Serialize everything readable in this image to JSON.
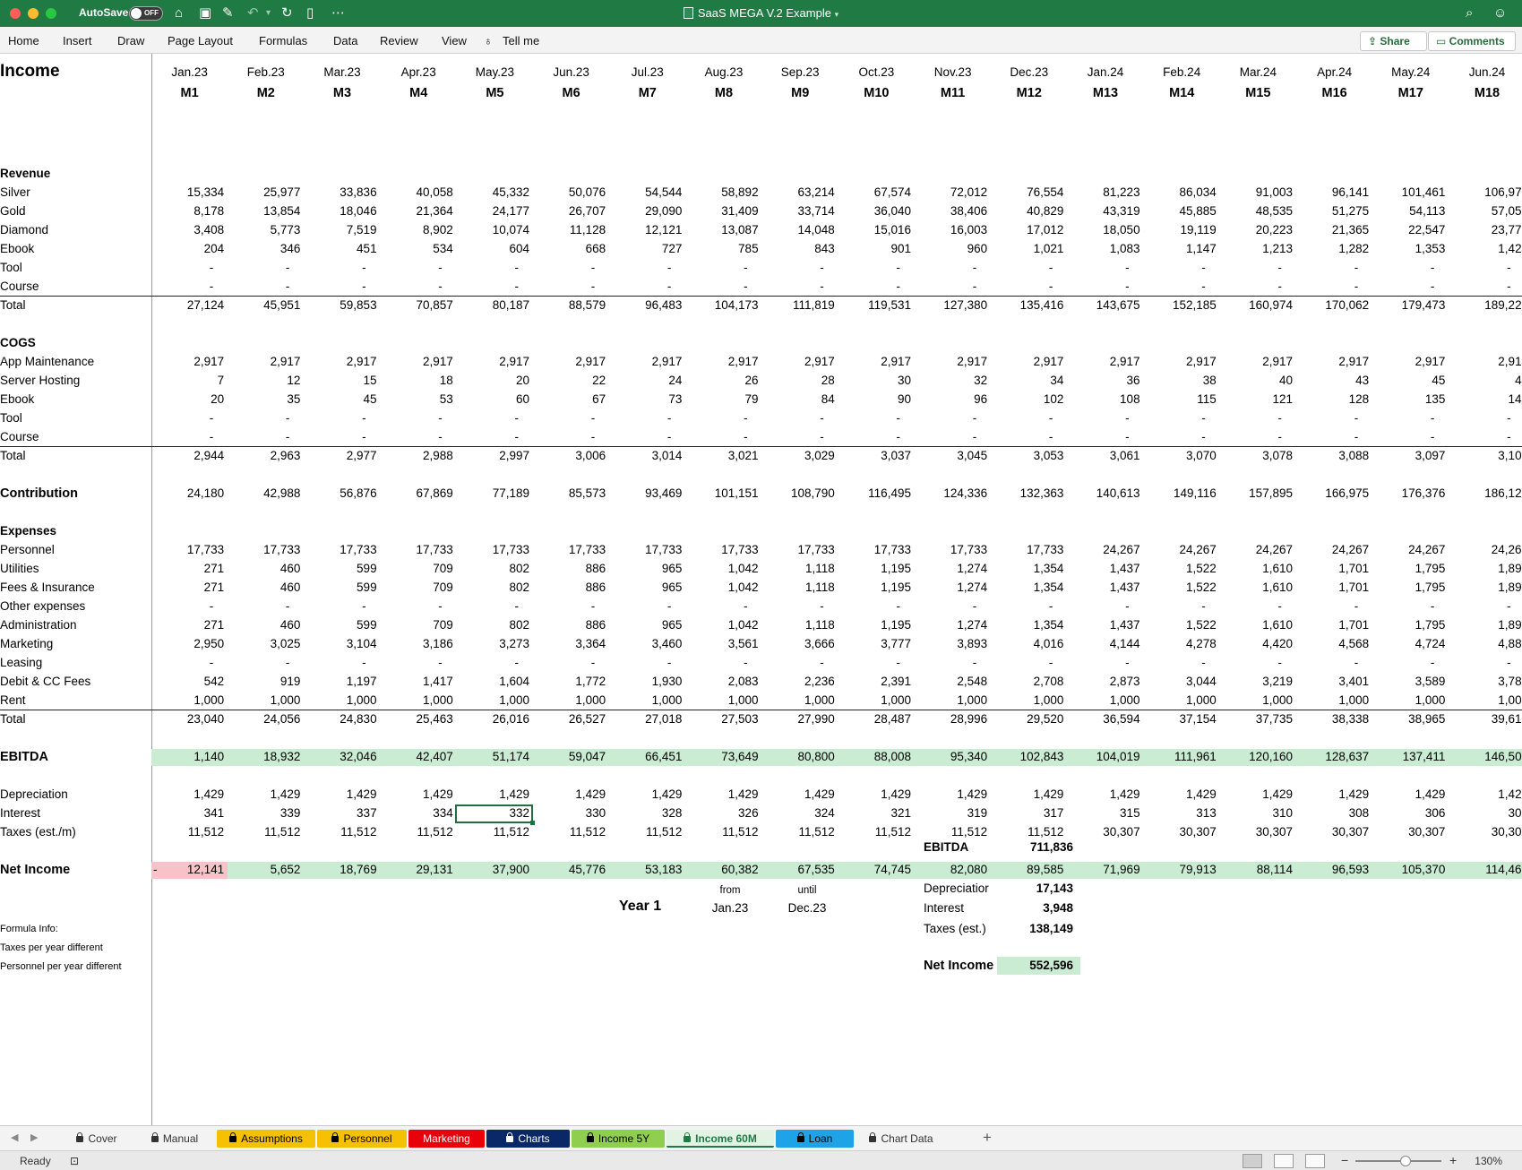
{
  "window": {
    "autosave_label": "AutoSave",
    "autosave_state": "OFF",
    "title": "SaaS MEGA V.2 Example"
  },
  "ribbon": {
    "tabs": [
      "Home",
      "Insert",
      "Draw",
      "Page Layout",
      "Formulas",
      "Data",
      "Review",
      "View",
      "Tell me"
    ],
    "share": "Share",
    "comments": "Comments"
  },
  "sheet": {
    "title": "Income",
    "dates": [
      "Jan.23",
      "Feb.23",
      "Mar.23",
      "Apr.23",
      "May.23",
      "Jun.23",
      "Jul.23",
      "Aug.23",
      "Sep.23",
      "Oct.23",
      "Nov.23",
      "Dec.23",
      "Jan.24",
      "Feb.24",
      "Mar.24",
      "Apr.24",
      "May.24",
      "Jun.24"
    ],
    "months": [
      "M1",
      "M2",
      "M3",
      "M4",
      "M5",
      "M6",
      "M7",
      "M8",
      "M9",
      "M10",
      "M11",
      "M12",
      "M13",
      "M14",
      "M15",
      "M16",
      "M17",
      "M18"
    ],
    "rows": [
      {
        "label": "Revenue",
        "bold": true,
        "values": []
      },
      {
        "label": "Silver",
        "values": [
          "15,334",
          "25,977",
          "33,836",
          "40,058",
          "45,332",
          "50,076",
          "54,544",
          "58,892",
          "63,214",
          "67,574",
          "72,012",
          "76,554",
          "81,223",
          "86,034",
          "91,003",
          "96,141",
          "101,461",
          "106,97"
        ]
      },
      {
        "label": "Gold",
        "values": [
          "8,178",
          "13,854",
          "18,046",
          "21,364",
          "24,177",
          "26,707",
          "29,090",
          "31,409",
          "33,714",
          "36,040",
          "38,406",
          "40,829",
          "43,319",
          "45,885",
          "48,535",
          "51,275",
          "54,113",
          "57,05"
        ]
      },
      {
        "label": "Diamond",
        "values": [
          "3,408",
          "5,773",
          "7,519",
          "8,902",
          "10,074",
          "11,128",
          "12,121",
          "13,087",
          "14,048",
          "15,016",
          "16,003",
          "17,012",
          "18,050",
          "19,119",
          "20,223",
          "21,365",
          "22,547",
          "23,77"
        ]
      },
      {
        "label": "Ebook",
        "values": [
          "204",
          "346",
          "451",
          "534",
          "604",
          "668",
          "727",
          "785",
          "843",
          "901",
          "960",
          "1,021",
          "1,083",
          "1,147",
          "1,213",
          "1,282",
          "1,353",
          "1,42"
        ]
      },
      {
        "label": "Tool",
        "dash": true,
        "values": [
          "-",
          "-",
          "-",
          "-",
          "-",
          "-",
          "-",
          "-",
          "-",
          "-",
          "-",
          "-",
          "-",
          "-",
          "-",
          "-",
          "-",
          "-"
        ]
      },
      {
        "label": "Course",
        "dash": true,
        "values": [
          "-",
          "-",
          "-",
          "-",
          "-",
          "-",
          "-",
          "-",
          "-",
          "-",
          "-",
          "-",
          "-",
          "-",
          "-",
          "-",
          "-",
          "-"
        ]
      },
      {
        "label": "Total",
        "line_above": true,
        "values": [
          "27,124",
          "45,951",
          "59,853",
          "70,857",
          "80,187",
          "88,579",
          "96,483",
          "104,173",
          "111,819",
          "119,531",
          "127,380",
          "135,416",
          "143,675",
          "152,185",
          "160,974",
          "170,062",
          "179,473",
          "189,22"
        ]
      },
      {
        "label": "",
        "values": []
      },
      {
        "label": "COGS",
        "bold": true,
        "values": []
      },
      {
        "label": "App Maintenance",
        "values": [
          "2,917",
          "2,917",
          "2,917",
          "2,917",
          "2,917",
          "2,917",
          "2,917",
          "2,917",
          "2,917",
          "2,917",
          "2,917",
          "2,917",
          "2,917",
          "2,917",
          "2,917",
          "2,917",
          "2,917",
          "2,91"
        ]
      },
      {
        "label": "Server Hosting",
        "values": [
          "7",
          "12",
          "15",
          "18",
          "20",
          "22",
          "24",
          "26",
          "28",
          "30",
          "32",
          "34",
          "36",
          "38",
          "40",
          "43",
          "45",
          "4"
        ]
      },
      {
        "label": "Ebook",
        "values": [
          "20",
          "35",
          "45",
          "53",
          "60",
          "67",
          "73",
          "79",
          "84",
          "90",
          "96",
          "102",
          "108",
          "115",
          "121",
          "128",
          "135",
          "14"
        ]
      },
      {
        "label": "Tool",
        "dash": true,
        "values": [
          "-",
          "-",
          "-",
          "-",
          "-",
          "-",
          "-",
          "-",
          "-",
          "-",
          "-",
          "-",
          "-",
          "-",
          "-",
          "-",
          "-",
          "-"
        ]
      },
      {
        "label": "Course",
        "dash": true,
        "values": [
          "-",
          "-",
          "-",
          "-",
          "-",
          "-",
          "-",
          "-",
          "-",
          "-",
          "-",
          "-",
          "-",
          "-",
          "-",
          "-",
          "-",
          "-"
        ]
      },
      {
        "label": "Total",
        "line_above": true,
        "values": [
          "2,944",
          "2,963",
          "2,977",
          "2,988",
          "2,997",
          "3,006",
          "3,014",
          "3,021",
          "3,029",
          "3,037",
          "3,045",
          "3,053",
          "3,061",
          "3,070",
          "3,078",
          "3,088",
          "3,097",
          "3,10"
        ]
      },
      {
        "label": "",
        "values": []
      },
      {
        "label": "Contribution",
        "bold": true,
        "values": [
          "24,180",
          "42,988",
          "56,876",
          "67,869",
          "77,189",
          "85,573",
          "93,469",
          "101,151",
          "108,790",
          "116,495",
          "124,336",
          "132,363",
          "140,613",
          "149,116",
          "157,895",
          "166,975",
          "176,376",
          "186,12"
        ]
      },
      {
        "label": "",
        "values": []
      },
      {
        "label": "Expenses",
        "bold": true,
        "values": []
      },
      {
        "label": "Personnel",
        "values": [
          "17,733",
          "17,733",
          "17,733",
          "17,733",
          "17,733",
          "17,733",
          "17,733",
          "17,733",
          "17,733",
          "17,733",
          "17,733",
          "17,733",
          "24,267",
          "24,267",
          "24,267",
          "24,267",
          "24,267",
          "24,26"
        ]
      },
      {
        "label": "Utilities",
        "values": [
          "271",
          "460",
          "599",
          "709",
          "802",
          "886",
          "965",
          "1,042",
          "1,118",
          "1,195",
          "1,274",
          "1,354",
          "1,437",
          "1,522",
          "1,610",
          "1,701",
          "1,795",
          "1,89"
        ]
      },
      {
        "label": "Fees & Insurance",
        "values": [
          "271",
          "460",
          "599",
          "709",
          "802",
          "886",
          "965",
          "1,042",
          "1,118",
          "1,195",
          "1,274",
          "1,354",
          "1,437",
          "1,522",
          "1,610",
          "1,701",
          "1,795",
          "1,89"
        ]
      },
      {
        "label": "Other expenses",
        "dash": true,
        "values": [
          "-",
          "-",
          "-",
          "-",
          "-",
          "-",
          "-",
          "-",
          "-",
          "-",
          "-",
          "-",
          "-",
          "-",
          "-",
          "-",
          "-",
          "-"
        ]
      },
      {
        "label": "Administration",
        "values": [
          "271",
          "460",
          "599",
          "709",
          "802",
          "886",
          "965",
          "1,042",
          "1,118",
          "1,195",
          "1,274",
          "1,354",
          "1,437",
          "1,522",
          "1,610",
          "1,701",
          "1,795",
          "1,89"
        ]
      },
      {
        "label": "Marketing",
        "values": [
          "2,950",
          "3,025",
          "3,104",
          "3,186",
          "3,273",
          "3,364",
          "3,460",
          "3,561",
          "3,666",
          "3,777",
          "3,893",
          "4,016",
          "4,144",
          "4,278",
          "4,420",
          "4,568",
          "4,724",
          "4,88"
        ]
      },
      {
        "label": "Leasing",
        "dash": true,
        "values": [
          "-",
          "-",
          "-",
          "-",
          "-",
          "-",
          "-",
          "-",
          "-",
          "-",
          "-",
          "-",
          "-",
          "-",
          "-",
          "-",
          "-",
          "-"
        ]
      },
      {
        "label": "Debit & CC Fees",
        "values": [
          "542",
          "919",
          "1,197",
          "1,417",
          "1,604",
          "1,772",
          "1,930",
          "2,083",
          "2,236",
          "2,391",
          "2,548",
          "2,708",
          "2,873",
          "3,044",
          "3,219",
          "3,401",
          "3,589",
          "3,78"
        ]
      },
      {
        "label": "Rent",
        "values": [
          "1,000",
          "1,000",
          "1,000",
          "1,000",
          "1,000",
          "1,000",
          "1,000",
          "1,000",
          "1,000",
          "1,000",
          "1,000",
          "1,000",
          "1,000",
          "1,000",
          "1,000",
          "1,000",
          "1,000",
          "1,00"
        ]
      },
      {
        "label": "Total",
        "line_above": true,
        "values": [
          "23,040",
          "24,056",
          "24,830",
          "25,463",
          "26,016",
          "26,527",
          "27,018",
          "27,503",
          "27,990",
          "28,487",
          "28,996",
          "29,520",
          "36,594",
          "37,154",
          "37,735",
          "38,338",
          "38,965",
          "39,61"
        ]
      },
      {
        "label": "",
        "values": []
      },
      {
        "label": "EBITDA",
        "bold": true,
        "highlight": "green",
        "values": [
          "1,140",
          "18,932",
          "32,046",
          "42,407",
          "51,174",
          "59,047",
          "66,451",
          "73,649",
          "80,800",
          "88,008",
          "95,340",
          "102,843",
          "104,019",
          "111,961",
          "120,160",
          "128,637",
          "137,411",
          "146,50"
        ]
      },
      {
        "label": "",
        "values": []
      },
      {
        "label": "Depreciation",
        "values": [
          "1,429",
          "1,429",
          "1,429",
          "1,429",
          "1,429",
          "1,429",
          "1,429",
          "1,429",
          "1,429",
          "1,429",
          "1,429",
          "1,429",
          "1,429",
          "1,429",
          "1,429",
          "1,429",
          "1,429",
          "1,42"
        ]
      },
      {
        "label": "Interest",
        "values": [
          "341",
          "339",
          "337",
          "334",
          "332",
          "330",
          "328",
          "326",
          "324",
          "321",
          "319",
          "317",
          "315",
          "313",
          "310",
          "308",
          "306",
          "30"
        ]
      },
      {
        "label": "Taxes (est./m)",
        "values": [
          "11,512",
          "11,512",
          "11,512",
          "11,512",
          "11,512",
          "11,512",
          "11,512",
          "11,512",
          "11,512",
          "11,512",
          "11,512",
          "11,512",
          "30,307",
          "30,307",
          "30,307",
          "30,307",
          "30,307",
          "30,30"
        ]
      },
      {
        "label": "",
        "values": []
      },
      {
        "label": "Net Income",
        "bold": true,
        "highlight": "green",
        "first_negative": true,
        "values": [
          "12,141",
          "5,652",
          "18,769",
          "29,131",
          "37,900",
          "45,776",
          "53,183",
          "60,382",
          "67,535",
          "74,745",
          "82,080",
          "89,585",
          "71,969",
          "79,913",
          "88,114",
          "96,593",
          "105,370",
          "114,46"
        ]
      }
    ],
    "negative_sign": "-",
    "selected_cell": {
      "row": 34,
      "col": 4
    }
  },
  "summary": {
    "ebitda_label": "EBITDA",
    "ebitda_value": "711,836",
    "from_label": "from",
    "until_label": "until",
    "period_label": "Year 1",
    "from_value": "Jan.23",
    "until_value": "Dec.23",
    "depreciation_label": "Depreciatior",
    "depreciation_value": "17,143",
    "interest_label": "Interest",
    "interest_value": "3,948",
    "taxes_label": "Taxes (est.)",
    "taxes_value": "138,149",
    "net_income_label": "Net Income",
    "net_income_value": "552,596"
  },
  "notes": [
    "Formula Info:",
    "Taxes per year different",
    "Personnel per year different"
  ],
  "sheet_tabs": [
    {
      "label": "Cover",
      "locked": true,
      "bg": "#f3f3f3",
      "fg": "#333333"
    },
    {
      "label": "Manual",
      "locked": true,
      "bg": "#f3f3f3",
      "fg": "#333333"
    },
    {
      "label": "Assumptions",
      "locked": true,
      "bg": "#f5c000",
      "fg": "#000000"
    },
    {
      "label": "Personnel",
      "locked": true,
      "bg": "#f5c000",
      "fg": "#000000"
    },
    {
      "label": "Marketing",
      "locked": false,
      "bg": "#e8000b",
      "fg": "#ffffff"
    },
    {
      "label": "Charts",
      "locked": true,
      "bg": "#0a2768",
      "fg": "#ffffff"
    },
    {
      "label": "Income 5Y",
      "locked": true,
      "bg": "#8fce4f",
      "fg": "#000000"
    },
    {
      "label": "Income 60M",
      "locked": true,
      "bg": "#e2f3e4",
      "fg": "#1f7a43",
      "active": true
    },
    {
      "label": "Loan",
      "locked": true,
      "bg": "#1ea3e6",
      "fg": "#000000"
    },
    {
      "label": "Chart Data",
      "locked": true,
      "bg": "#f3f3f3",
      "fg": "#333333"
    }
  ],
  "status": {
    "ready": "Ready",
    "zoom": "130%"
  }
}
